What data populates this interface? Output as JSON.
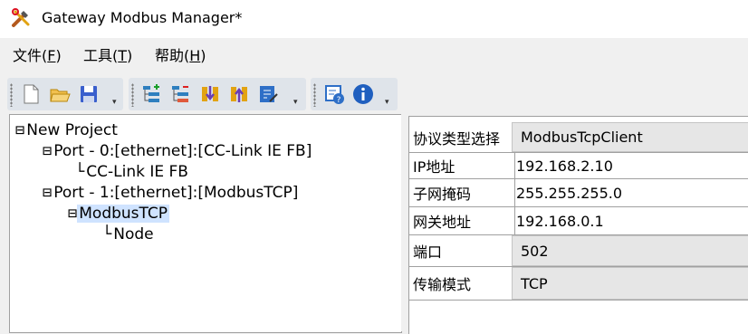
{
  "window": {
    "title": "Gateway Modbus Manager*",
    "app_icon": "tools-icon"
  },
  "menu": [
    {
      "text": "文件(",
      "key": "F",
      "end": ")"
    },
    {
      "text": "工具(",
      "key": "T",
      "end": ")"
    },
    {
      "text": "帮助(",
      "key": "H",
      "end": ")"
    }
  ],
  "toolbar": {
    "group1": [
      "new-file-icon",
      "open-folder-icon",
      "save-icon"
    ],
    "group2": [
      "add-node-icon",
      "remove-node-icon",
      "download-icon",
      "upload-icon",
      "edit-icon"
    ],
    "group3": [
      "settings-help-icon",
      "info-icon"
    ]
  },
  "tree": {
    "root": {
      "glyph": "⊟",
      "label": "New Project"
    },
    "port0": {
      "glyph": "⊟",
      "label": "Port - 0:[ethernet]:[CC-Link IE FB]"
    },
    "port0_child": {
      "glyph": "└",
      "label": "CC-Link IE FB"
    },
    "port1": {
      "glyph": "⊟",
      "label": "Port - 1:[ethernet]:[ModbusTCP]"
    },
    "modbus": {
      "glyph": "⊟",
      "label": "ModbusTCP"
    },
    "node": {
      "glyph": "└",
      "label": "Node"
    }
  },
  "properties": [
    {
      "name": "协议类型选择",
      "value": "ModbusTcpClient"
    },
    {
      "name": "IP地址",
      "value": "192.168.2.10"
    },
    {
      "name": "子网掩码",
      "value": "255.255.255.0"
    },
    {
      "name": "网关地址",
      "value": "192.168.0.1"
    },
    {
      "name": "端口",
      "value": "502"
    },
    {
      "name": "传输模式",
      "value": "TCP"
    }
  ]
}
